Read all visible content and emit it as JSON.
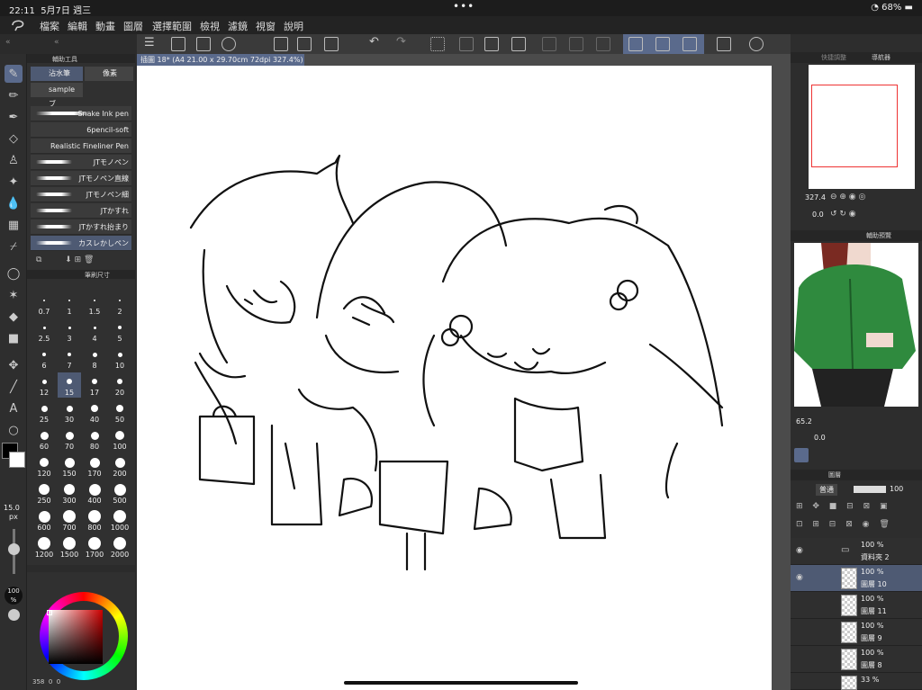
{
  "status": {
    "time": "22:11",
    "date": "5月7日 週三",
    "dots": "•••",
    "battery": "68%"
  },
  "menu": [
    "檔案",
    "編輯",
    "動畫",
    "圖層",
    "選擇範圍",
    "檢視",
    "濾鏡",
    "視窗",
    "說明"
  ],
  "document": {
    "tab_title": "插圖 18* (A4 21.00 x 29.70cm 72dpi 327.4%)"
  },
  "subtool": {
    "header": "輔助工具",
    "tabs": [
      "沾水筆",
      "像素",
      "sample ブ"
    ],
    "brushes": [
      "Snake Ink pen",
      "6pencil-soft",
      "Realistic Fineliner Pen",
      "JTモノペン",
      "JTモノペン直線",
      "JTモノペン細",
      "JTかすれ",
      "JTかすれ抬まり",
      "カスレかしペン"
    ]
  },
  "brushsize": {
    "header": "筆刷尺寸",
    "values": [
      "0.7",
      "1",
      "1.5",
      "2",
      "2.5",
      "3",
      "4",
      "5",
      "6",
      "7",
      "8",
      "10",
      "12",
      "15",
      "17",
      "20",
      "25",
      "30",
      "40",
      "50",
      "60",
      "70",
      "80",
      "100",
      "120",
      "150",
      "170",
      "200",
      "250",
      "300",
      "400",
      "500",
      "600",
      "700",
      "800",
      "1000",
      "1200",
      "1500",
      "1700",
      "2000"
    ],
    "selected": "15",
    "size_readout": "15.0",
    "size_unit": "px",
    "opacity_readout": "100",
    "opacity_unit": "%"
  },
  "color": {
    "footer": "358",
    "footer_b": "0",
    "footer_c": "0"
  },
  "navigator": {
    "tab_a": "快捷調整",
    "tab_b": "導航器",
    "zoom": "327.4",
    "rotation": "0.0"
  },
  "subview": {
    "tab": "輔助預覽",
    "zoom": "65.2",
    "rotation": "0.0"
  },
  "layers": {
    "header": "圖層",
    "blend_mode": "普通",
    "opacity": "100",
    "items": [
      {
        "opacity": "100 %",
        "name": "資料夾 2"
      },
      {
        "opacity": "100 %",
        "name": "圖層 10"
      },
      {
        "opacity": "100 %",
        "name": "圖層 11"
      },
      {
        "opacity": "100 %",
        "name": "圖層 9"
      },
      {
        "opacity": "100 %",
        "name": "圖層 8"
      },
      {
        "opacity": "33 %",
        "name": ""
      }
    ]
  },
  "colors": {
    "accent": "#5a6a8c",
    "panel": "#303030"
  }
}
